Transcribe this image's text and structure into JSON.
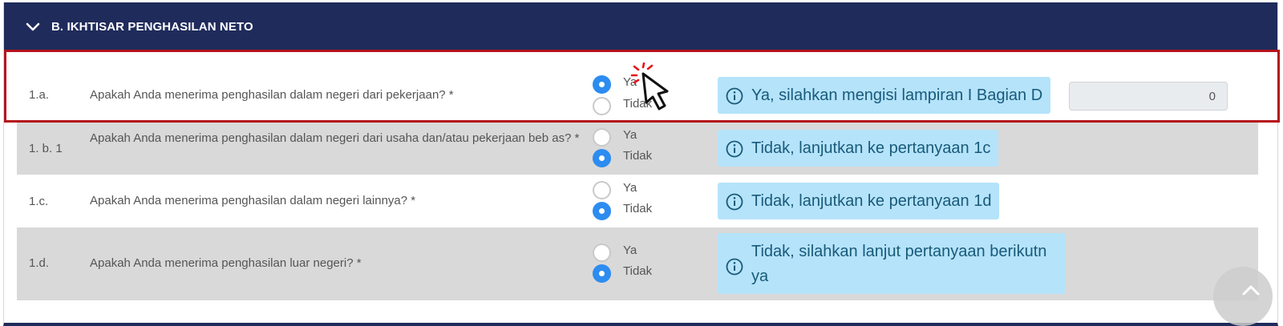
{
  "section": {
    "title": "B. IKHTISAR PENGHASILAN NETO"
  },
  "options": {
    "yes": "Ya",
    "no": "Tidak"
  },
  "questions": [
    {
      "number": "1.a.",
      "text": "Apakah Anda menerima penghasilan dalam negeri dari pekerjaan? *",
      "selected": "Ya",
      "hint": "Ya, silahkan mengisi lampiran I Bagian D",
      "amount": "0"
    },
    {
      "number": "1. b. 1",
      "text": "Apakah Anda menerima penghasilan dalam negeri dari usaha dan/atau pekerjaan beb as? *",
      "selected": "Tidak",
      "hint": "Tidak, lanjutkan ke pertanyaan 1c"
    },
    {
      "number": "1.c.",
      "text": "Apakah Anda menerima penghasilan dalam negeri lainnya? *",
      "selected": "Tidak",
      "hint": "Tidak, lanjutkan ke pertanyaan 1d"
    },
    {
      "number": "1.d.",
      "text": "Apakah Anda menerima penghasilan luar negeri? *",
      "selected": "Tidak",
      "hint": "Tidak, silahkan lanjut pertanyaan berikutn ya"
    }
  ],
  "colors": {
    "header_bg": "#1f2b5b",
    "radio_checked": "#2d8cf0",
    "hint_bg": "#b5e3fa",
    "highlight_border": "#b5121b"
  },
  "icons": [
    "chevron-down-icon",
    "info-icon",
    "pointer-cursor-icon",
    "chevron-up-icon"
  ]
}
